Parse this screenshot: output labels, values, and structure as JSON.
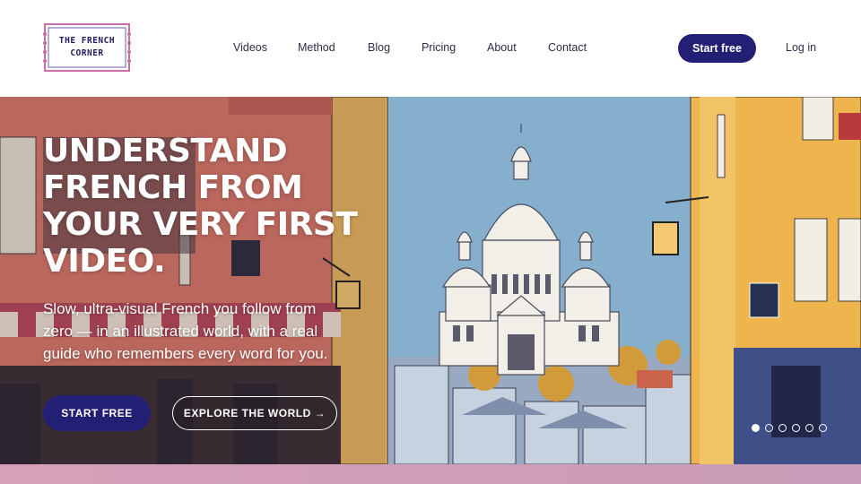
{
  "brand": {
    "line1": "THE FRENCH",
    "line2": "CORNER"
  },
  "nav": {
    "items": [
      {
        "label": "Videos"
      },
      {
        "label": "Method"
      },
      {
        "label": "Blog"
      },
      {
        "label": "Pricing"
      },
      {
        "label": "About"
      },
      {
        "label": "Contact"
      }
    ],
    "start_label": "Start free",
    "login_label": "Log in"
  },
  "hero": {
    "title": "UNDERSTAND FRENCH FROM YOUR VERY FIRST VIDEO.",
    "subtitle": "Slow, ultra-visual French you follow from zero — in an illustrated world, with a real guide who remembers every word for you.",
    "primary_cta": "START FREE",
    "secondary_cta": "EXPLORE THE WORLD →",
    "carousel": {
      "slides": 6,
      "active": 1
    }
  },
  "colors": {
    "brand_navy": "#221f74",
    "sky": "#7fa8c9",
    "left_building": "#d9786a",
    "right_building": "#eeb54e",
    "basilica": "#f2efe8"
  }
}
